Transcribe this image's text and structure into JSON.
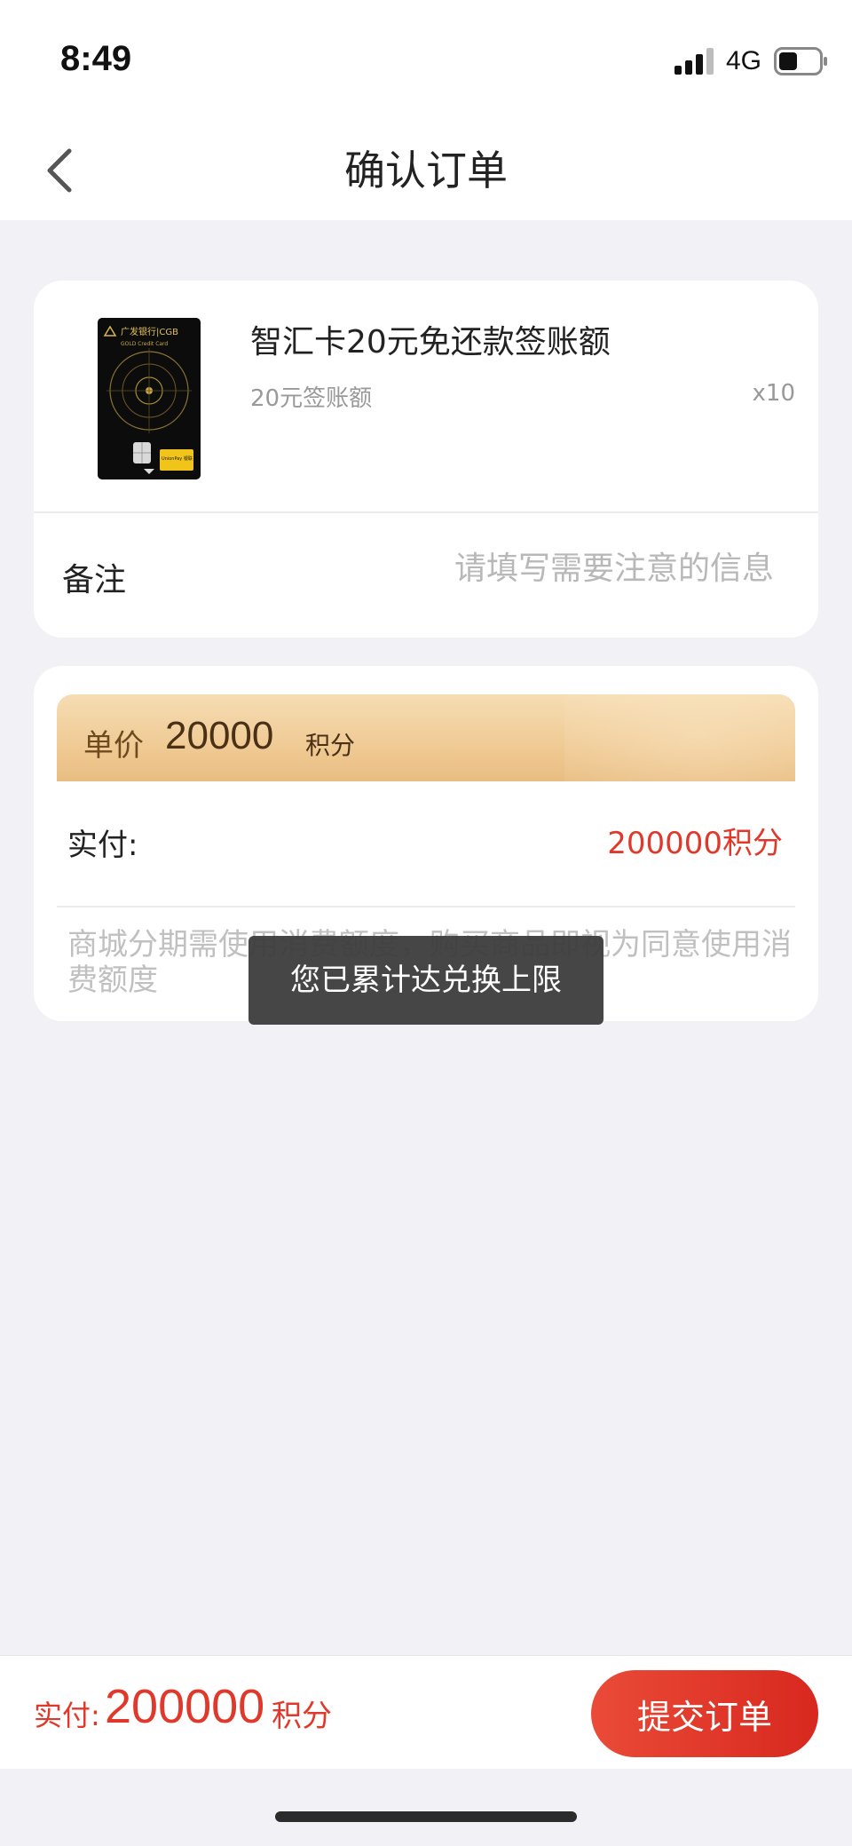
{
  "status_bar": {
    "time": "8:49",
    "network": "4G",
    "icons": [
      "signal-icon",
      "battery-icon"
    ]
  },
  "nav": {
    "title": "确认订单",
    "back_icon": "chevron-left-icon"
  },
  "product": {
    "title": "智汇卡20元免还款签账额",
    "subtitle": "20元签账额",
    "quantity": "x10",
    "image_text": {
      "bank": "广发银行|CGB",
      "card_name": "GOLD Credit Card",
      "network_logo": "UnionPay 银联"
    }
  },
  "remark": {
    "label": "备注",
    "placeholder": "请填写需要注意的信息",
    "value": ""
  },
  "price": {
    "unit_label": "单价",
    "unit_value": "20000",
    "unit_suffix": "积分",
    "paid_label": "实付:",
    "paid_value": "200000积分",
    "notice": "商城分期需使用消费额度，购买商品即视为同意使用消费额度"
  },
  "toast": {
    "message": "您已累计达兑换上限"
  },
  "bottom_bar": {
    "total_label": "实付:",
    "total_value": "200000",
    "total_suffix": "积分",
    "submit_label": "提交订单"
  },
  "colors": {
    "accent_red": "#e0392c",
    "gold_light": "#f6ddb4",
    "gold_dark": "#e8bd82",
    "background": "#f2f2f6"
  }
}
